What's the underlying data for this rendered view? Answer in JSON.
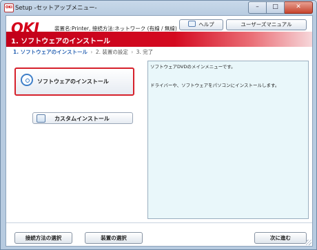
{
  "window": {
    "title": "Setup -セットアップメニュー-",
    "app_icon": "OKI",
    "controls": {
      "minimize": "–",
      "maximize": "□",
      "close": "✕"
    }
  },
  "header": {
    "logo": "OKI",
    "device_info": "装置名:Printer, 接続方法:ネットワーク (有線 / 無線)",
    "help_label": "ヘルプ",
    "manual_label": "ユーザーズマニュアル"
  },
  "banner": {
    "title": "1. ソフトウェアのインストール"
  },
  "breadcrumb": {
    "step1": "1. ソフトウェアのインストール",
    "step2": "2. 装置の設定",
    "step3": "3. 完了",
    "separator": "›"
  },
  "options": {
    "install_label": "ソフトウェアのインストール",
    "custom_label": "カスタムインストール"
  },
  "description": {
    "line1": "ソフトウェアDVDのメインメニューです。",
    "line2": "ドライバーや、ソフトウェアをパソコンにインストールします。"
  },
  "footer": {
    "connection_label": "接続方法の選択",
    "device_label": "装置の選択",
    "next_label": "次に進む"
  },
  "colors": {
    "brand_red": "#d4001a",
    "panel_bg": "#e9f7fa",
    "accent_blue": "#2a64b4"
  }
}
